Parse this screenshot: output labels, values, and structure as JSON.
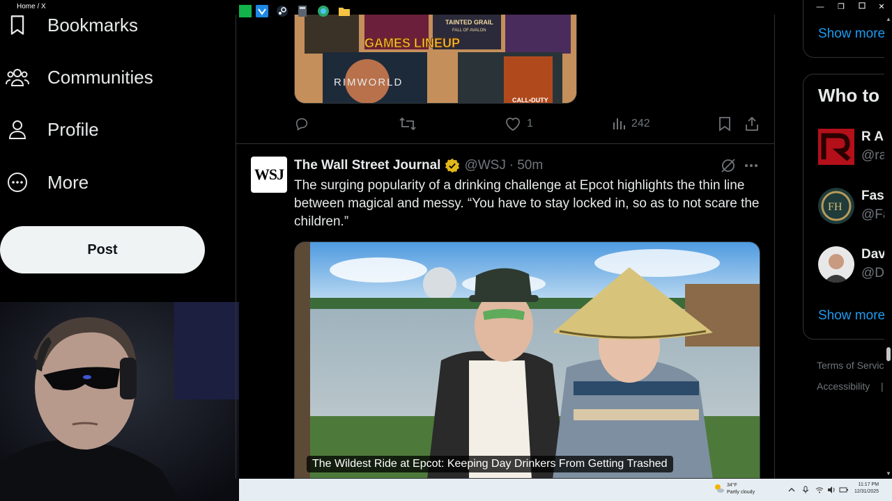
{
  "window": {
    "title": "Home / X",
    "minimize": "—",
    "restore": "❐",
    "close": "✕"
  },
  "nav": {
    "items": [
      {
        "label": "Bookmarks",
        "icon": "bookmark-icon"
      },
      {
        "label": "Communities",
        "icon": "communities-icon"
      },
      {
        "label": "Profile",
        "icon": "profile-icon"
      },
      {
        "label": "More",
        "icon": "more-circle-icon"
      }
    ],
    "post_label": "Post"
  },
  "prev_tweet": {
    "media_text": {
      "games_lineup": "GAMES LINEUP",
      "tainted_grail": "TAINTED GRAIL",
      "tainted_sub": "FALL OF AVALON",
      "rimworld": "RIMWORLD",
      "cod": "CALL•DUTY"
    },
    "actions": {
      "likes": "1",
      "views": "242"
    }
  },
  "tweet": {
    "avatar_text": "WSJ",
    "author": "The Wall Street Journal",
    "handle": "@WSJ",
    "dot": "·",
    "time": "50m",
    "text": "The surging popularity of a drinking challenge at Epcot highlights the thin line between magical and messy. “You have to stay locked in, so as to not scare the children.”",
    "media_caption": "The Wildest Ride at Epcot: Keeping Day Drinkers From Getting Trashed"
  },
  "right": {
    "show_more_label": "Show more",
    "who_to_follow_title": "Who to",
    "suggestions": [
      {
        "name": "R A",
        "handle": "@ra"
      },
      {
        "name": "Fas",
        "handle": "@Fa"
      },
      {
        "name": "Dav",
        "handle": "@Da"
      }
    ],
    "footer": {
      "terms": "Terms of Servic",
      "accessibility": "Accessibility",
      "pipe": "|"
    }
  },
  "taskbar": {
    "weather_temp": "34°F",
    "weather_desc": "Partly cloudy",
    "time": "11:17 PM",
    "date": "12/31/2025"
  },
  "colors": {
    "accent": "#1d9bf0",
    "verified_gold": "#e2b719",
    "muted": "#71767b",
    "border": "#2f3336"
  }
}
